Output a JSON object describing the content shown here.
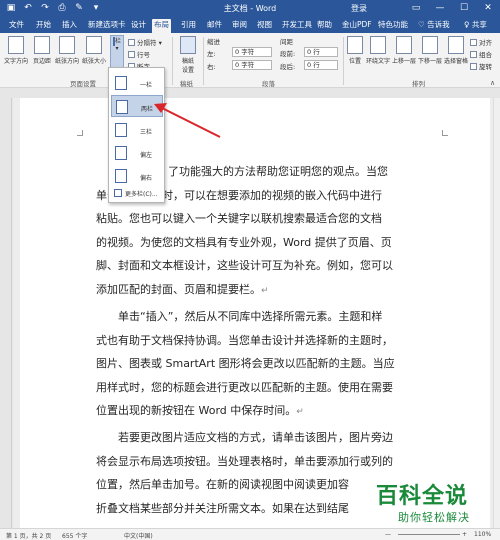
{
  "titlebar": {
    "title": "主文档 - Word",
    "user": "登录",
    "qa_icons": [
      "save-icon",
      "undo-icon",
      "redo-icon",
      "print-icon",
      "format-painter-icon",
      "quick-access-more-icon"
    ],
    "window_controls": [
      "ribbon-display-icon",
      "minimize-icon",
      "restore-icon",
      "close-icon"
    ],
    "glyphs": {
      "save": "▣",
      "undo": "↶",
      "redo": "↷",
      "print": "⎙",
      "brush": "✎",
      "more": "▾",
      "display": "▭",
      "min": "—",
      "max": "☐",
      "close": "✕"
    },
    "bg_color": "#2b579a"
  },
  "tabs": [
    {
      "label": "文件"
    },
    {
      "label": "开始"
    },
    {
      "label": "插入"
    },
    {
      "label": "新建选项卡"
    },
    {
      "label": "设计"
    },
    {
      "label": "布局",
      "active": true
    },
    {
      "label": "引用"
    },
    {
      "label": "邮件"
    },
    {
      "label": "审阅"
    },
    {
      "label": "视图"
    },
    {
      "label": "开发工具"
    },
    {
      "label": "帮助"
    },
    {
      "label": "金山PDF"
    },
    {
      "label": "特色功能"
    }
  ],
  "tellme": "♡ 告诉我",
  "share": "♀ 共享",
  "ribbon": {
    "page_setup": {
      "label": "页面设置",
      "buttons": [
        "文字方向",
        "页边距",
        "纸张方向",
        "纸张大小"
      ],
      "columns": "栏",
      "breaks": "分隔符",
      "line_numbers": "行号",
      "hyphenation": "断字",
      "columns_arrow": "▾",
      "breaks_arrow": "▾"
    },
    "draft": {
      "line1": "稿纸",
      "line2": "设置",
      "label": "稿纸"
    },
    "indent": {
      "title": "缩进",
      "left_label": "左:",
      "left_value": "0 字符",
      "right_label": "右:",
      "right_value": "0 字符"
    },
    "spacing": {
      "title": "间距",
      "before_label": "段前:",
      "before_value": "0 行",
      "after_label": "段后:",
      "after_value": "0 行"
    },
    "paragraph_label": "段落",
    "arrange": {
      "label": "排列",
      "buttons": [
        "位置",
        "环绕文字",
        "上移一层",
        "下移一层",
        "选择窗格"
      ],
      "small": [
        "对齐",
        "组合",
        "旋转"
      ]
    },
    "collapse_glyph": "∧"
  },
  "dropdown": {
    "items": [
      {
        "label": "一栏"
      },
      {
        "label": "两栏",
        "hover": true
      },
      {
        "label": "三栏"
      },
      {
        "label": "偏左"
      },
      {
        "label": "偏右"
      }
    ],
    "more": "更多栏(C)..."
  },
  "document": {
    "para1": [
      "了功能强大的方法帮助您证明您的观点。当您",
      "单击联机视频时，可以在想要添加的视频的嵌入代码中进行",
      "粘贴。您也可以键入一个关键字以联机搜索最适合您的文档",
      "的视频。为使您的文档具有专业外观，Word 提供了页眉、页",
      "脚、封面和文本框设计，这些设计可互为补充。例如，您可以",
      "添加匹配的封面、页眉和提要栏。"
    ],
    "para2": [
      "单击“插入”，然后从不同库中选择所需元素。主题和样",
      "式也有助于文档保持协调。当您单击设计并选择新的主题时，",
      "图片、图表或 SmartArt 图形将会更改以匹配新的主题。当应",
      "用样式时，您的标题会进行更改以匹配新的主题。使用在需要",
      "位置出现的新按钮在 Word 中保存时间。"
    ],
    "para3": [
      "若要更改图片适应文档的方式，请单击该图片，图片旁边",
      "将会显示布局选项按钮。当处理表格时，单击要添加行或列的",
      "位置，然后单击加号。在新的阅读视图中阅读更加容",
      "折叠文档某些部分并关注所需文本。如果在达到结尾"
    ],
    "para_mark": "↵"
  },
  "statusbar": {
    "page": "第 1 页，共 2 页",
    "words": "655 个字",
    "lang": "中文(中国)",
    "zoom": "110%",
    "zoom_minus": "—",
    "zoom_plus": "+"
  },
  "watermark": {
    "big": "百科全说",
    "small": "助你轻松解决"
  },
  "colors": {
    "word_blue": "#2b579a",
    "arrow_red": "#d9262b",
    "watermark_green": "#1a8a3a",
    "hover": "#c5d3e8"
  }
}
